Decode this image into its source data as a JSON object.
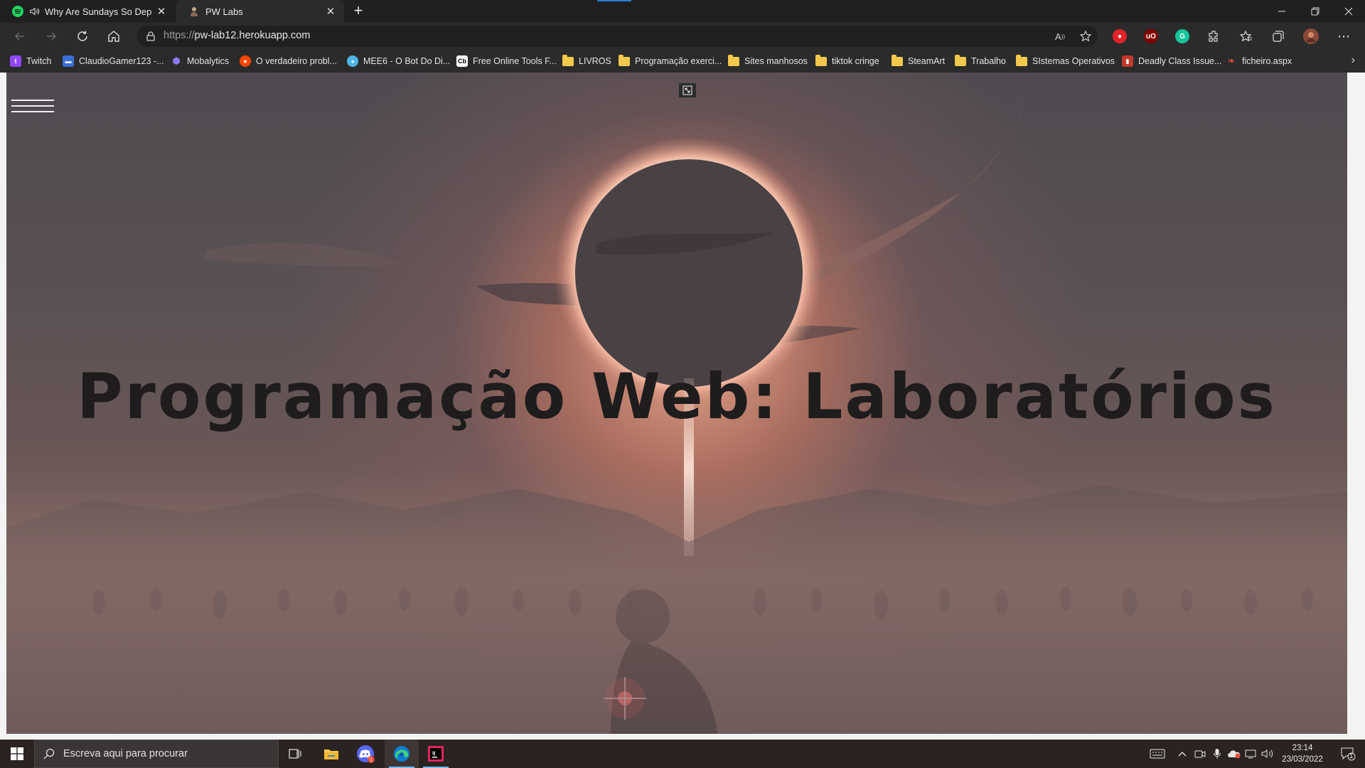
{
  "browser": {
    "tabs": [
      {
        "title": "Why Are Sundays So Depressing",
        "favicon": "spotify-icon",
        "audio_icon": "speaker-icon"
      },
      {
        "title": "PW Labs",
        "favicon": "site-favicon"
      }
    ],
    "new_tab_symbol": "+",
    "url": {
      "scheme": "https://",
      "host": "pw-lab12.herokuapp.com"
    },
    "bookmarks": [
      {
        "label": "Twitch",
        "icon": "twitch-icon",
        "color": "#9146ff"
      },
      {
        "label": "ClaudioGamer123 -...",
        "icon": "site-icon",
        "color": "#3b6fd8"
      },
      {
        "label": "Mobalytics",
        "icon": "shield-icon",
        "color": "#6a5acd"
      },
      {
        "label": "O verdadeiro probl...",
        "icon": "reddit-icon",
        "color": "#ff4500"
      },
      {
        "label": "MEE6 - O Bot Do Di...",
        "icon": "mee6-icon",
        "color": "#4fb5e6"
      },
      {
        "label": "Free Online Tools F...",
        "icon": "tools-icon",
        "color": "#ffffff"
      },
      {
        "label": "LIVROS",
        "icon": "folder-icon"
      },
      {
        "label": "Programação exerci...",
        "icon": "folder-icon"
      },
      {
        "label": "Sites manhosos",
        "icon": "folder-icon"
      },
      {
        "label": "tiktok cringe",
        "icon": "folder-icon"
      },
      {
        "label": "SteamArt",
        "icon": "folder-icon"
      },
      {
        "label": "Trabalho",
        "icon": "folder-icon"
      },
      {
        "label": "SIstemas Operativos",
        "icon": "folder-icon"
      },
      {
        "label": "Deadly Class Issue...",
        "icon": "comic-icon",
        "color": "#c0392b"
      },
      {
        "label": "ficheiro.aspx",
        "icon": "file-icon",
        "color": "#e74c3c"
      }
    ]
  },
  "page": {
    "heading": "Programação Web: Laboratórios",
    "menu_icon": "hamburger-icon",
    "fullscreen_icon": "fullscreen-icon"
  },
  "taskbar": {
    "search_placeholder": "Escreva aqui para procurar",
    "time": "23:14",
    "date": "23/03/2022",
    "notification_count": "1"
  },
  "colors": {
    "accent": "#77b7f0",
    "heading": "#1e1c1d",
    "chrome_dark": "#202020",
    "chrome_mid": "#2b2b2b"
  }
}
